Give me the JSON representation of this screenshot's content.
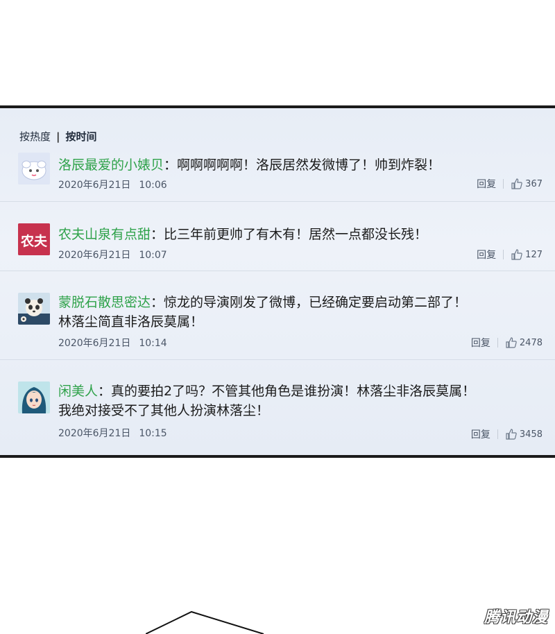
{
  "sort": {
    "hot_label": "按热度",
    "separator": "|",
    "time_label": "按时间"
  },
  "comments": [
    {
      "user": "洛辰最爱的小婊贝",
      "text": "：啊啊啊啊啊！洛辰居然发微博了！帅到炸裂！",
      "date": "2020年6月21日",
      "time": "10:06",
      "reply_label": "回复",
      "likes": "367",
      "avatar": "cartoon-sheep-avatar"
    },
    {
      "user": "农夫山泉有点甜",
      "text": "：比三年前更帅了有木有！居然一点都没长残！",
      "date": "2020年6月21日",
      "time": "10:07",
      "reply_label": "回复",
      "likes": "127",
      "avatar_text": "农夫",
      "avatar_color": "#c7324e"
    },
    {
      "user": "蒙脱石散思密达",
      "text": "：惊龙的导演刚发了微博，已经确定要启动第二部了！",
      "text2": "林落尘简直非洛辰莫属！",
      "date": "2020年6月21日",
      "time": "10:14",
      "reply_label": "回复",
      "likes": "2478",
      "avatar": "panda-avatar"
    },
    {
      "user": "闲美人",
      "text": "：真的要拍2了吗？不管其他角色是谁扮演！林落尘非洛辰莫属！",
      "text2": "我绝对接受不了其他人扮演林落尘！",
      "date": "2020年6月21日",
      "time": "10:15",
      "reply_label": "回复",
      "likes": "3458",
      "avatar": "anime-girl-avatar"
    }
  ],
  "watermark": "腾讯动漫"
}
